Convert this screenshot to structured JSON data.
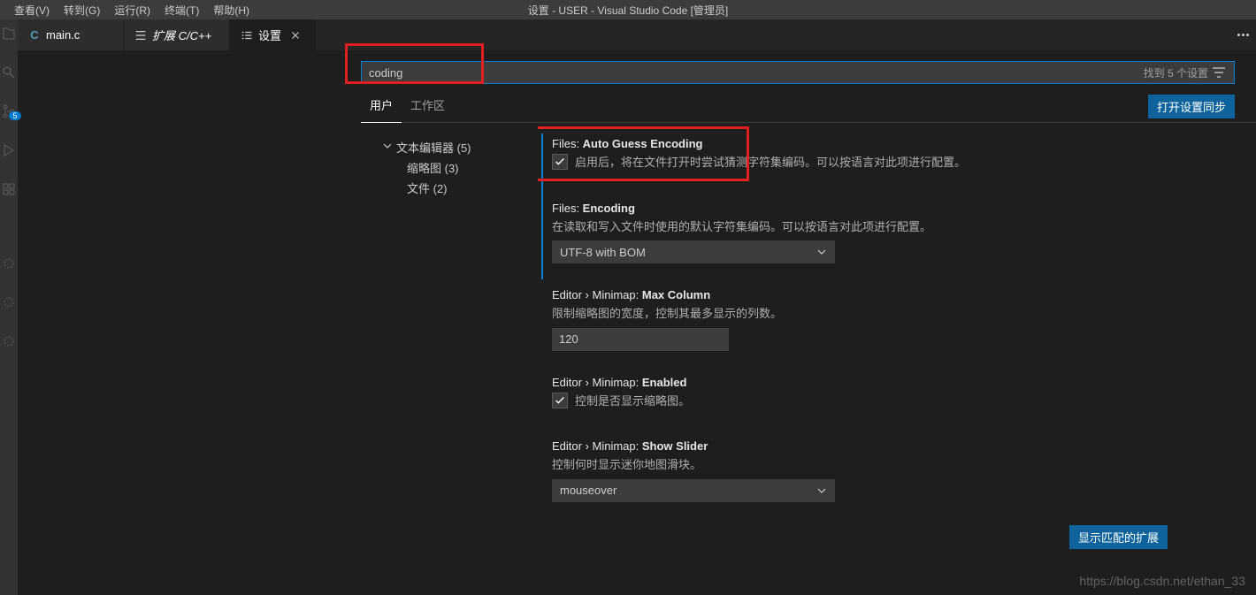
{
  "window": {
    "title": "设置 - USER - Visual Studio Code [管理员]"
  },
  "menu": {
    "view": "查看(V)",
    "goto": "转到(G)",
    "run": "运行(R)",
    "terminal": "终端(T)",
    "help": "帮助(H)"
  },
  "tabs": {
    "t1": {
      "label": "main.c"
    },
    "t2": {
      "label": "扩展 C/C++"
    },
    "t3": {
      "label": "设置"
    }
  },
  "activity": {
    "badge": "5"
  },
  "search": {
    "value": "coding",
    "count": "找到 5 个设置"
  },
  "scope": {
    "user": "用户",
    "workspace": "工作区",
    "sync": "打开设置同步"
  },
  "toc": {
    "root": "文本编辑器 (5)",
    "sub1": "缩略图  (3)",
    "sub2": "文件  (2)"
  },
  "settings": {
    "s1": {
      "title_prefix": "Files: ",
      "title_bold": "Auto Guess Encoding",
      "desc": "启用后，将在文件打开时尝试猜测字符集编码。可以按语言对此项进行配置。"
    },
    "s2": {
      "title_prefix": "Files: ",
      "title_bold": "Encoding",
      "desc": "在读取和写入文件时使用的默认字符集编码。可以按语言对此项进行配置。",
      "value": "UTF-8 with BOM"
    },
    "s3": {
      "title_prefix": "Editor › Minimap: ",
      "title_bold": "Max Column",
      "desc": "限制缩略图的宽度，控制其最多显示的列数。",
      "value": "120"
    },
    "s4": {
      "title_prefix": "Editor › Minimap: ",
      "title_bold": "Enabled",
      "desc": "控制是否显示缩略图。"
    },
    "s5": {
      "title_prefix": "Editor › Minimap: ",
      "title_bold": "Show Slider",
      "desc": "控制何时显示迷你地图滑块。",
      "value": "mouseover"
    }
  },
  "footer": {
    "show_ext": "显示匹配的扩展"
  },
  "watermark": "https://blog.csdn.net/ethan_33"
}
